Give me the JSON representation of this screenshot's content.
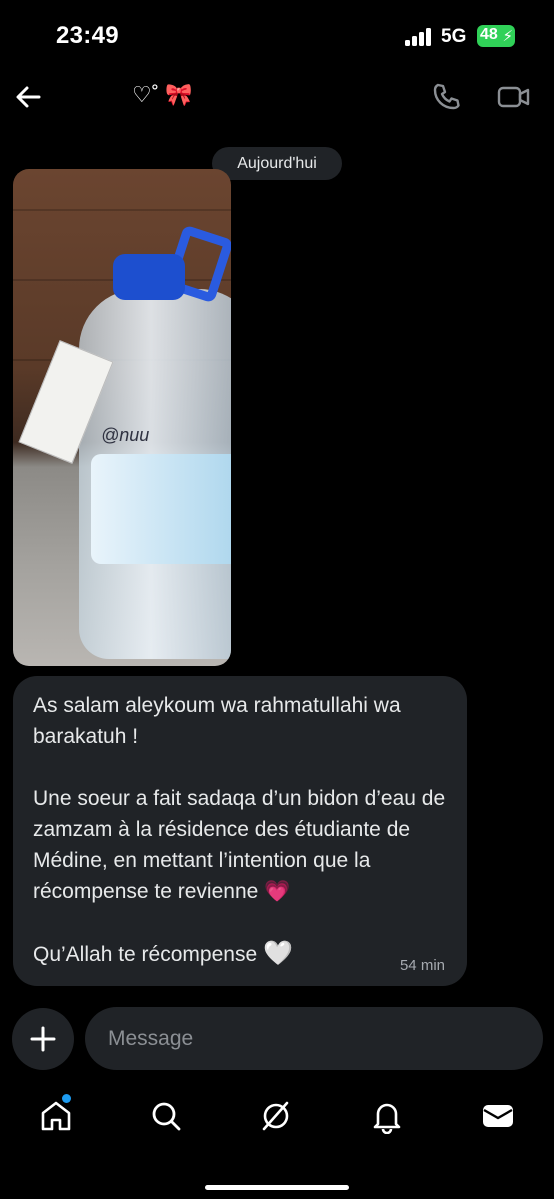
{
  "status_bar": {
    "time": "23:49",
    "network": "5G",
    "battery": "48"
  },
  "header": {
    "title_heart": "♡˚",
    "title_bow": "🎀",
    "back_icon": "arrow-left-icon",
    "call_icon": "phone-icon",
    "video_icon": "video-camera-icon"
  },
  "conversation": {
    "date_separator": "Aujourd'hui",
    "photo_writing": "@nuu",
    "message": {
      "paragraph1": "As salam aleykoum wa rahmatullahi wa barakatuh !",
      "paragraph2": "Une soeur a fait sadaqa d’un bidon d’eau de zamzam à la résidence des étudiante de Médine, en mettant l’intention que la récompense te revienne",
      "paragraph2_emoji": "💗",
      "paragraph3": "Qu’Allah te récompense",
      "paragraph3_emoji": "🤍",
      "timestamp": "54 min"
    }
  },
  "composer": {
    "add_icon": "plus-icon",
    "placeholder": "Message"
  },
  "bottom_nav": {
    "items": [
      "home-icon",
      "search-icon",
      "grok-icon",
      "notifications-bell-icon",
      "messages-envelope-icon"
    ],
    "active_dot_color": "#1d9bf0"
  },
  "colors": {
    "background": "#000000",
    "bubble": "#202327",
    "battery": "#30d158",
    "accent": "#1d9bf0"
  }
}
